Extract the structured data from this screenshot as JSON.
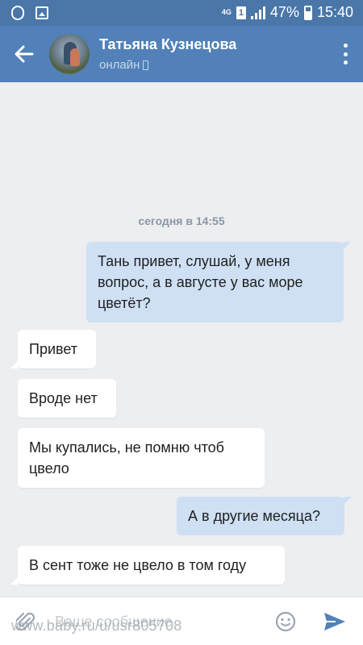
{
  "status_bar": {
    "network": "4G",
    "sim": "1",
    "battery_percent": "47%",
    "time": "15:40"
  },
  "header": {
    "contact_name": "Татьяна Кузнецова",
    "contact_status": "онлайн"
  },
  "chat": {
    "date_divider": "сегодня в 14:55",
    "messages": [
      {
        "direction": "out",
        "text": "Тань привет, слушай, у меня вопрос,  а в августе у вас море цветёт?"
      },
      {
        "direction": "in",
        "text": "Привет"
      },
      {
        "direction": "in",
        "text": "Вроде нет"
      },
      {
        "direction": "in",
        "text": "Мы купались, не помню чтоб цвело"
      },
      {
        "direction": "out",
        "text": "А в другие месяца?"
      },
      {
        "direction": "in",
        "text": "В сент тоже не цвело в том году"
      }
    ]
  },
  "composer": {
    "placeholder": "Ваше сообщение"
  },
  "watermark": "www.baby.ru/u/usr805708",
  "colors": {
    "header": "#5181b8",
    "status_bar": "#4a76a8",
    "chat_background": "#edeef0",
    "outgoing_bubble": "#cfe0f4",
    "incoming_bubble": "#ffffff",
    "send_icon": "#5181b8"
  },
  "icons": [
    "back-arrow-icon",
    "phone-icon",
    "more-vertical-icon",
    "attach-icon",
    "emoji-icon",
    "send-icon"
  ]
}
